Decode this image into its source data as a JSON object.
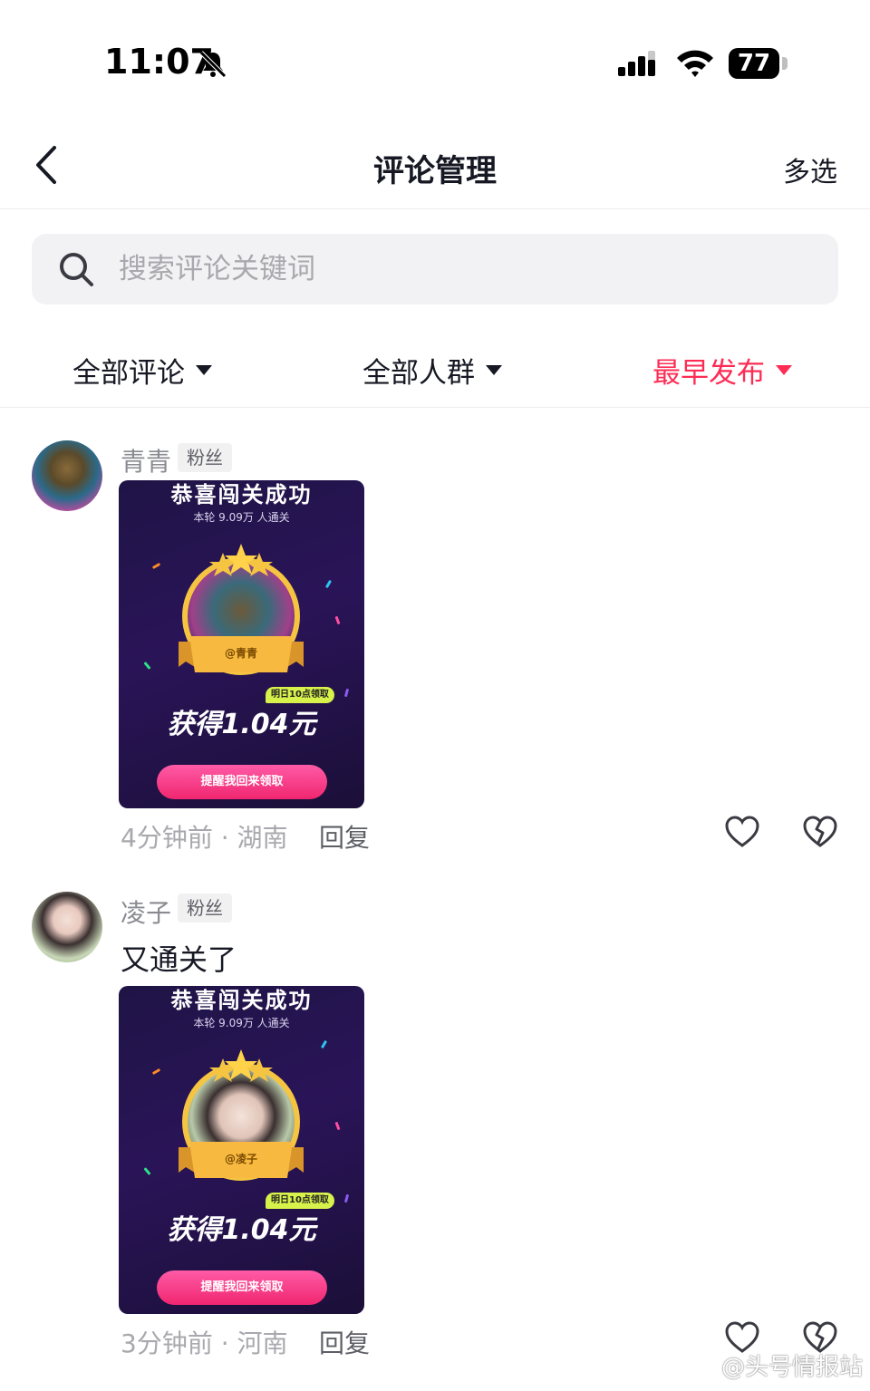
{
  "status_bar": {
    "time": "11:07",
    "battery": "77"
  },
  "nav": {
    "title": "评论管理",
    "multi_select": "多选"
  },
  "search": {
    "placeholder": "搜索评论关键词"
  },
  "filters": [
    {
      "label": "全部评论",
      "active": false
    },
    {
      "label": "全部人群",
      "active": false
    },
    {
      "label": "最早发布",
      "active": true
    }
  ],
  "colors": {
    "accent": "#fe2c55",
    "text_primary": "#161823",
    "text_secondary": "#a8a8ae"
  },
  "comments": [
    {
      "username": "青青",
      "badge": "粉丝",
      "text": "",
      "card": {
        "title": "恭喜闯关成功",
        "stats": "本轮 9.09万 人通关",
        "name_tag": "@青青",
        "tag": "明日10点领取",
        "reward": "获得1.04元",
        "button": "提醒我回来领取"
      },
      "meta": "4分钟前 · 湖南",
      "reply": "回复"
    },
    {
      "username": "凌子",
      "badge": "粉丝",
      "text": "又通关了",
      "card": {
        "title": "恭喜闯关成功",
        "stats": "本轮 9.09万 人通关",
        "name_tag": "@凌子",
        "tag": "明日10点领取",
        "reward": "获得1.04元",
        "button": "提醒我回来领取"
      },
      "meta": "3分钟前 · 河南",
      "reply": "回复"
    }
  ],
  "watermark": "@头号情报站"
}
